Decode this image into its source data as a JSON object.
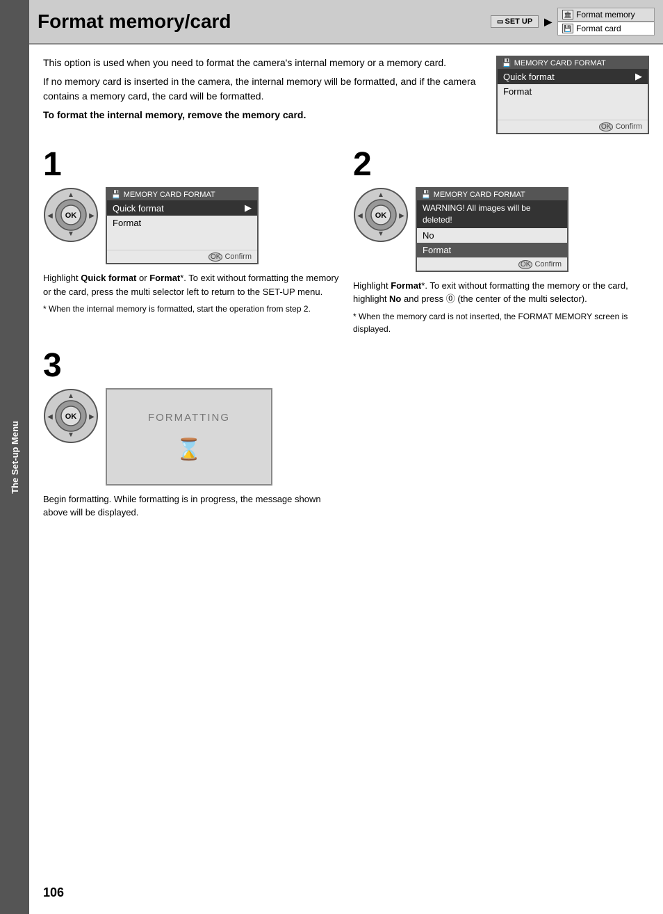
{
  "sidebar": {
    "label": "The Set-up Menu"
  },
  "header": {
    "title": "Format memory/card",
    "setup_label": "SET UP",
    "menu_items": [
      {
        "icon": "📷",
        "label": "Format memory",
        "selected": true
      },
      {
        "icon": "💾",
        "label": "Format card",
        "selected": false
      }
    ]
  },
  "intro": {
    "para1": "This option is used when you need to format the camera's internal memory or a memory card.",
    "para2": "If no memory card is inserted in the camera, the internal memory will be formatted, and if the camera contains a memory card, the card will be formatted.",
    "bold_line": "To format the internal memory, remove the memory card."
  },
  "lcd_preview": {
    "title": "MEMORY CARD FORMAT",
    "items": [
      "Quick format",
      "Format"
    ],
    "selected": "Quick format",
    "confirm_label": "Confirm"
  },
  "step1": {
    "number": "1",
    "screen_title": "MEMORY CARD FORMAT",
    "screen_items": [
      "Quick format",
      "Format"
    ],
    "screen_selected": "Quick format",
    "confirm_label": "Confirm",
    "text": "Highlight Quick format or Format*. To exit without formatting the memory or the card, press the multi selector left to return to the SET-UP menu.",
    "footnote": "* When the internal memory is formatted, start the operation from step 2."
  },
  "step2": {
    "number": "2",
    "screen_title": "MEMORY CARD FORMAT",
    "warning_text": "WARNING! All images will be deleted!",
    "no_label": "No",
    "format_label": "Format",
    "confirm_label": "Confirm",
    "text": "Highlight Format*. To exit without formatting the memory or the card, highlight No and press OK (the center of the multi selector).",
    "footnote": "* When the memory card is not inserted, the FORMAT MEMORY screen is displayed."
  },
  "step3": {
    "number": "3",
    "formatting_label": "FORMATTING",
    "text": "Begin formatting. While formatting is in progress, the message shown above will be displayed."
  },
  "page_number": "106"
}
